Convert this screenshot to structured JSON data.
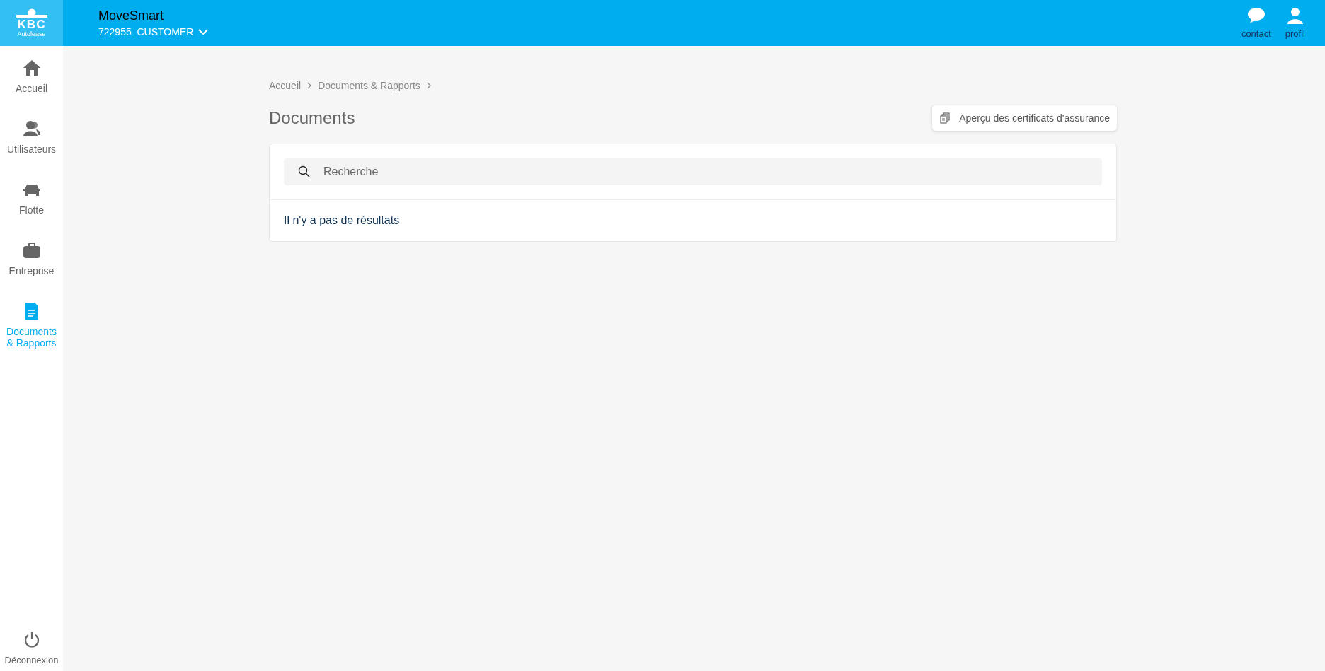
{
  "logo": {
    "brand": "KBC",
    "subtitle": "Autolease"
  },
  "header": {
    "app_name": "MoveSmart",
    "account": "722955_CUSTOMER",
    "actions": [
      {
        "kind": "contact",
        "label": "contact"
      },
      {
        "kind": "profile",
        "label": "profil"
      }
    ]
  },
  "sidebar": {
    "items": [
      {
        "kind": "home",
        "label": "Accueil",
        "selected": false
      },
      {
        "kind": "users",
        "label": "Utilisateurs",
        "selected": false
      },
      {
        "kind": "car",
        "label": "Flotte",
        "selected": false
      },
      {
        "kind": "briefcase",
        "label": "Entreprise",
        "selected": false
      },
      {
        "kind": "document",
        "label": "Documents\n& Rapports",
        "selected": true
      }
    ],
    "logout": "Déconnexion"
  },
  "breadcrumb": [
    "Accueil",
    "Documents & Rapports"
  ],
  "page_title": "Documents",
  "certificates_button": "Aperçu des certificats d'assurance",
  "search": {
    "placeholder": "Recherche"
  },
  "empty_message": "Il n'y a pas de résultats"
}
